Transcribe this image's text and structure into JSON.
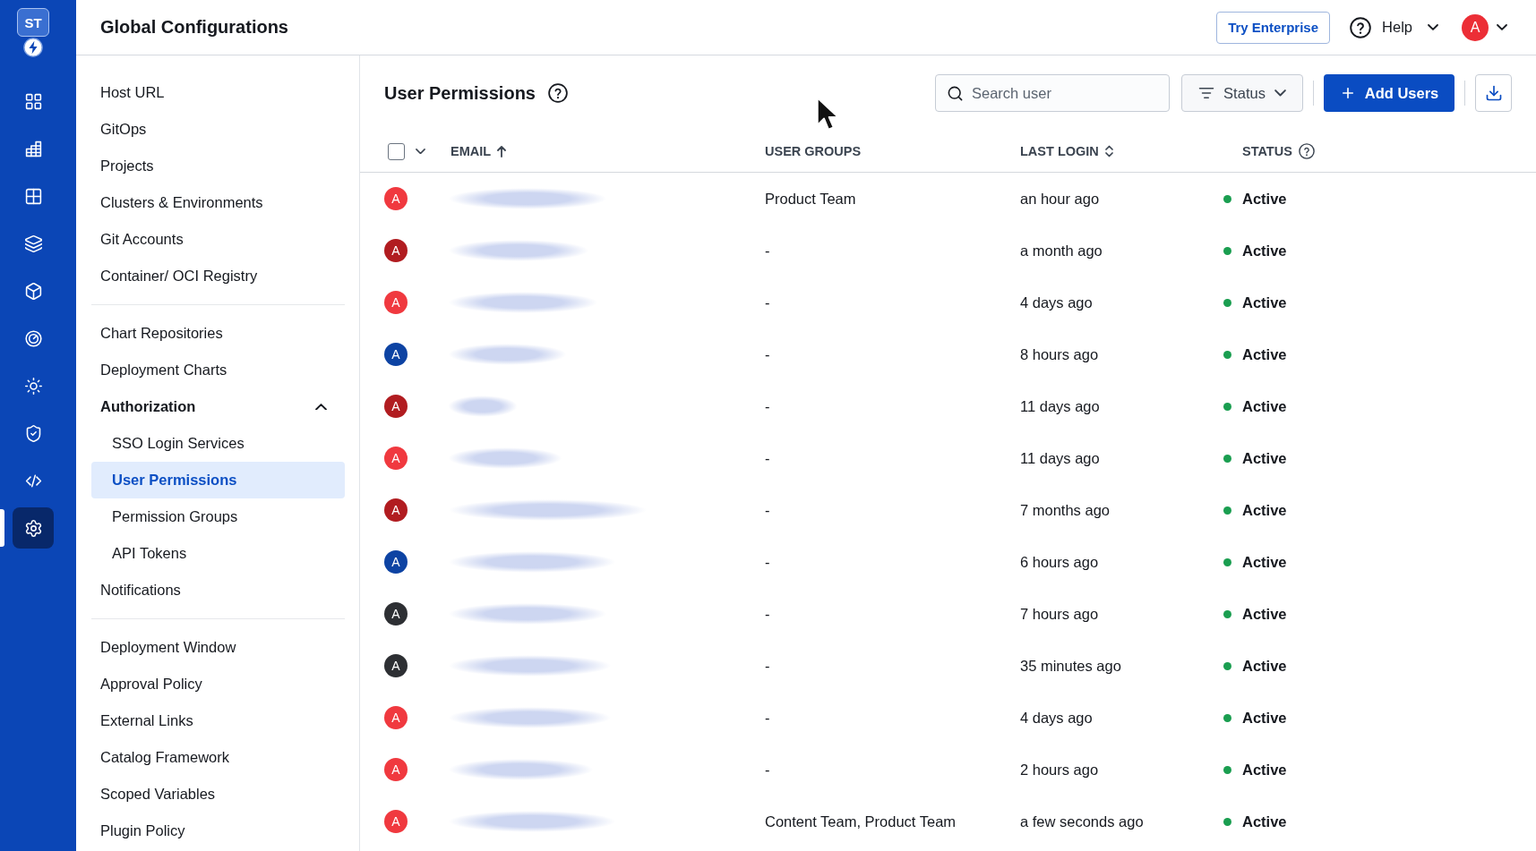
{
  "rail": {
    "logo": "ST",
    "items": [
      {
        "kind": "apps",
        "selected": false
      },
      {
        "kind": "chart-grid",
        "selected": false
      },
      {
        "kind": "grid",
        "selected": false
      },
      {
        "kind": "layers",
        "selected": false
      },
      {
        "kind": "cube",
        "selected": false
      },
      {
        "kind": "target",
        "selected": false
      },
      {
        "kind": "sun",
        "selected": false
      },
      {
        "kind": "shield",
        "selected": false
      },
      {
        "kind": "code",
        "selected": false
      },
      {
        "kind": "settings",
        "selected": true
      }
    ]
  },
  "header": {
    "title": "Global Configurations",
    "enterprise_button": "Try Enterprise",
    "help": "Help",
    "user_avatar": "A"
  },
  "sidebar": {
    "groups": [
      {
        "items": [
          {
            "label": "Host URL",
            "selected": false
          },
          {
            "label": "GitOps",
            "selected": false
          },
          {
            "label": "Projects",
            "selected": false
          },
          {
            "label": "Clusters & Environments",
            "selected": false
          },
          {
            "label": "Git Accounts",
            "selected": false
          },
          {
            "label": "Container/ OCI Registry",
            "selected": false
          }
        ]
      },
      {
        "items": [
          {
            "label": "Chart Repositories",
            "selected": false
          },
          {
            "label": "Deployment Charts",
            "selected": false
          },
          {
            "label": "Authorization",
            "selected": false,
            "expanded": true,
            "children": [
              {
                "label": "SSO Login Services",
                "selected": false
              },
              {
                "label": "User Permissions",
                "selected": true
              },
              {
                "label": "Permission Groups",
                "selected": false
              },
              {
                "label": "API Tokens",
                "selected": false
              }
            ]
          },
          {
            "label": "Notifications",
            "selected": false
          }
        ]
      },
      {
        "items": [
          {
            "label": "Deployment Window",
            "selected": false
          },
          {
            "label": "Approval Policy",
            "selected": false
          },
          {
            "label": "External Links",
            "selected": false
          },
          {
            "label": "Catalog Framework",
            "selected": false
          },
          {
            "label": "Scoped Variables",
            "selected": false
          },
          {
            "label": "Plugin Policy",
            "selected": false
          }
        ]
      }
    ]
  },
  "page": {
    "title": "User Permissions",
    "search": {
      "placeholder": "Search user"
    },
    "filter": "Status",
    "add_button": "Add Users"
  },
  "table": {
    "select_all": {
      "checked": false
    },
    "columns": [
      {
        "label": "EMAIL",
        "sorted": true
      },
      {
        "label": "USER GROUPS"
      },
      {
        "label": "LAST LOGIN",
        "sorted": false
      },
      {
        "label": "STATUS",
        "help": true
      }
    ],
    "rows": [
      {
        "avatar": "A",
        "color": "#f0393f",
        "user_groups": "Product Team",
        "last_login": "an hour ago",
        "status": "Active"
      },
      {
        "avatar": "A",
        "color": "#b11c20",
        "user_groups": "-",
        "last_login": "a month ago",
        "status": "Active"
      },
      {
        "avatar": "A",
        "color": "#f0393f",
        "user_groups": "-",
        "last_login": "4 days ago",
        "status": "Active"
      },
      {
        "avatar": "A",
        "color": "#0d43a3",
        "user_groups": "-",
        "last_login": "8 hours ago",
        "status": "Active"
      },
      {
        "avatar": "A",
        "color": "#b11c20",
        "user_groups": "-",
        "last_login": "11 days ago",
        "status": "Active"
      },
      {
        "avatar": "A",
        "color": "#f0393f",
        "user_groups": "-",
        "last_login": "11 days ago",
        "status": "Active"
      },
      {
        "avatar": "A",
        "color": "#b11c20",
        "user_groups": "-",
        "last_login": "7 months ago",
        "status": "Active"
      },
      {
        "avatar": "A",
        "color": "#0d43a3",
        "user_groups": "-",
        "last_login": "6 hours ago",
        "status": "Active"
      },
      {
        "avatar": "A",
        "color": "#2d2f33",
        "user_groups": "-",
        "last_login": "7 hours ago",
        "status": "Active"
      },
      {
        "avatar": "A",
        "color": "#2d2f33",
        "user_groups": "-",
        "last_login": "35 minutes ago",
        "status": "Active"
      },
      {
        "avatar": "A",
        "color": "#f0393f",
        "user_groups": "-",
        "last_login": "4 days ago",
        "status": "Active"
      },
      {
        "avatar": "A",
        "color": "#f0393f",
        "user_groups": "-",
        "last_login": "2 hours ago",
        "status": "Active"
      },
      {
        "avatar": "A",
        "color": "#f0393f",
        "user_groups": "Content Team, Product Team",
        "last_login": "a few seconds ago",
        "status": "Active"
      }
    ]
  }
}
